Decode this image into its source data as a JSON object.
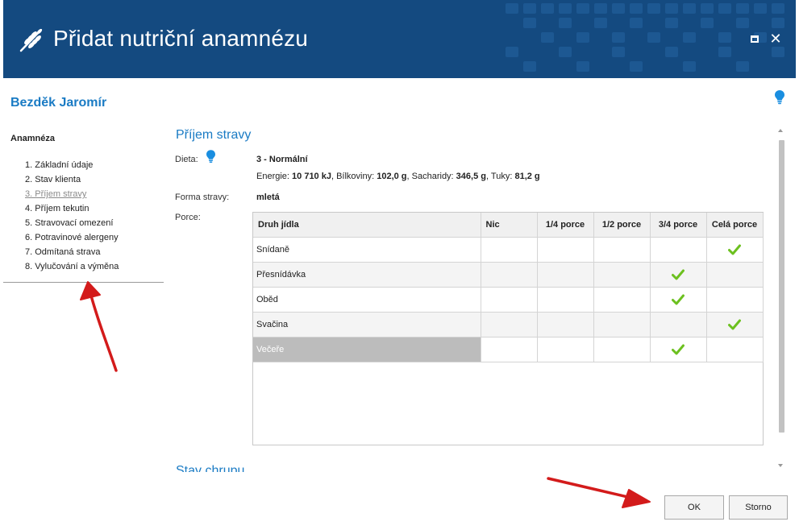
{
  "window": {
    "title": "Přidat nutriční anamnézu"
  },
  "patient": {
    "name": "Bezděk Jaromír"
  },
  "nav": {
    "title": "Anamnéza",
    "items": [
      {
        "label": "1. Základní údaje"
      },
      {
        "label": "2. Stav klienta"
      },
      {
        "label": "3. Příjem stravy"
      },
      {
        "label": "4. Příjem tekutin"
      },
      {
        "label": "5. Stravovací omezení"
      },
      {
        "label": "6. Potravinové alergeny"
      },
      {
        "label": "7. Odmítaná strava"
      },
      {
        "label": "8. Vylučování a výměna"
      }
    ],
    "active_index": 2
  },
  "section": {
    "title": "Příjem stravy",
    "diet_label": "Dieta:",
    "diet_value": "3 - Normální",
    "energy_prefix": "Energie: ",
    "energy_value": "10 710 kJ",
    "protein_prefix": ", Bílkoviny: ",
    "protein_value": "102,0 g",
    "carbs_prefix": ", Sacharidy: ",
    "carbs_value": "346,5 g",
    "fat_prefix": ", Tuky: ",
    "fat_value": "81,2 g",
    "form_label": "Forma stravy:",
    "form_value": "mletá",
    "portions_label": "Porce:",
    "next_section_title": "Stav chrupu"
  },
  "portions_table": {
    "columns": [
      "Druh jídla",
      "Nic",
      "1/4 porce",
      "1/2 porce",
      "3/4 porce",
      "Celá porce"
    ],
    "rows": [
      {
        "meal": "Snídaně",
        "checked": 4
      },
      {
        "meal": "Přesnídávka",
        "checked": 3
      },
      {
        "meal": "Oběd",
        "checked": 3
      },
      {
        "meal": "Svačina",
        "checked": 4
      },
      {
        "meal": "Večeře",
        "checked": 3
      }
    ],
    "selected_row": 4
  },
  "buttons": {
    "ok": "OK",
    "cancel": "Storno"
  },
  "colors": {
    "titlebar": "#144a80",
    "accent": "#1a7bc4",
    "check": "#6cc01f",
    "annotation_arrow": "#d31b1b"
  },
  "icons": {
    "app": "wheat-icon",
    "hint": "lightbulb-icon",
    "check": "checkmark-icon",
    "maximize": "maximize-icon",
    "close": "close-icon"
  }
}
